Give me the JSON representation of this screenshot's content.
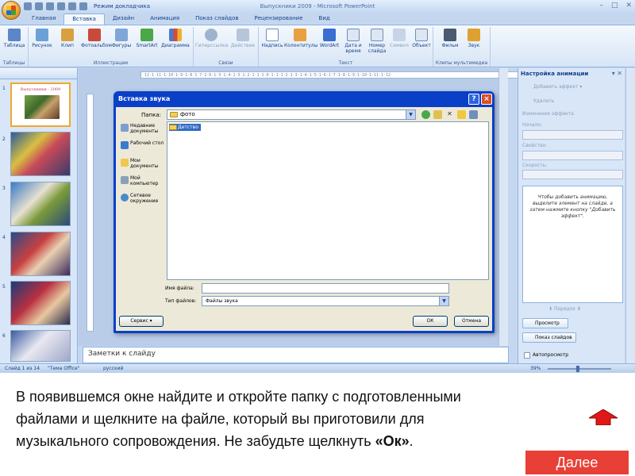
{
  "window": {
    "title": "Выпускники 2009 - Microsoft PowerPoint",
    "qat_mode": "Режим докладчика"
  },
  "tabs": [
    "Главная",
    "Вставка",
    "Дизайн",
    "Анимация",
    "Показ слайдов",
    "Рецензирование",
    "Вид"
  ],
  "active_tab": "Вставка",
  "ribbon": {
    "groups": [
      {
        "label": "Таблицы",
        "buttons": [
          "Таблица"
        ]
      },
      {
        "label": "Иллюстрации",
        "buttons": [
          "Рисунок",
          "Клип",
          "Фотоальбом",
          "Фигуры",
          "SmartArt",
          "Диаграмма"
        ]
      },
      {
        "label": "Связи",
        "buttons": [
          "Гиперссылка",
          "Действие"
        ]
      },
      {
        "label": "Текст",
        "buttons": [
          "Надпись",
          "Колонтитулы",
          "WordArt",
          "Дата и время",
          "Номер слайда",
          "Символ",
          "Объект"
        ]
      },
      {
        "label": "Клипы мультимедиа",
        "buttons": [
          "Фильм",
          "Звук"
        ]
      }
    ]
  },
  "slides_panel": {
    "first_slide_title": "Выпускники - 2009",
    "numbers": [
      "1",
      "2",
      "3",
      "4",
      "5",
      "6"
    ]
  },
  "ruler_text": "12·1·11·1·10·1·9·1·8·1·7·1·6·1·5·1·4·1·3·1·2·1·1·1·0·1·1·1·2·1·3·1·4·1·5·1·6·1·7·1·8·1·9·1·10·1·11·1·12",
  "dialog": {
    "title": "Вставка звука",
    "look_in_label": "Папка:",
    "look_in_value": "фото",
    "places": [
      "Недавние документы",
      "Рабочий стол",
      "Мои документы",
      "Мой компьютер",
      "Сетевое окружение"
    ],
    "files": [
      "Детство"
    ],
    "filename_label": "Имя файла:",
    "filename_value": "",
    "filetype_label": "Тип файлов:",
    "filetype_value": "Файлы звука",
    "service_button": "Сервис",
    "ok_button": "ОК",
    "cancel_button": "Отмена"
  },
  "notes_placeholder": "Заметки к слайду",
  "task_pane": {
    "title": "Настройка анимации",
    "add_effect": "Добавить эффект",
    "remove": "Удалить",
    "change_effect": "Изменение эффекта",
    "start_label": "Начало:",
    "property_label": "Свойство:",
    "speed_label": "Скорость:",
    "hint": "Чтобы добавить анимацию, выделите элемент на слайде, а затем нажмите кнопку \"Добавить эффект\".",
    "reorder": "Порядок",
    "preview": "Просмотр",
    "slideshow": "Показ слайдов",
    "autopreview": "Автопросмотр"
  },
  "status_bar": {
    "slide_counter": "Слайд 1 из 14",
    "theme": "\"Тема Office\"",
    "language": "русский",
    "zoom": "39%"
  },
  "instruction": {
    "line1": "В появившемся окне найдите и откройте папку с подготовленными",
    "line2": "файлами  и щелкните на файле,  который вы приготовили для",
    "line3_start": "музыкального сопровождения.   Не забудьте щелкнуть ",
    "line3_bold": "«Ок»",
    "line3_end": "."
  },
  "next_button": "Далее",
  "colors": {
    "accent_red": "#e84036",
    "ribbon_blue": "#c5d7ef",
    "dialog_title_blue": "#0a3fc8"
  }
}
